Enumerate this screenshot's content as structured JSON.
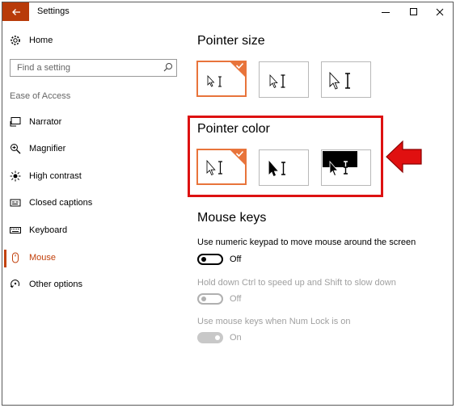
{
  "window": {
    "title": "Settings",
    "accent_color": "#b83b0a"
  },
  "sidebar": {
    "home_label": "Home",
    "search_placeholder": "Find a setting",
    "group_label": "Ease of Access",
    "items": [
      {
        "label": "Narrator",
        "icon": "narrator-icon"
      },
      {
        "label": "Magnifier",
        "icon": "magnifier-icon"
      },
      {
        "label": "High contrast",
        "icon": "high-contrast-icon"
      },
      {
        "label": "Closed captions",
        "icon": "closed-captions-icon"
      },
      {
        "label": "Keyboard",
        "icon": "keyboard-icon"
      },
      {
        "label": "Mouse",
        "icon": "mouse-icon",
        "active": true
      },
      {
        "label": "Other options",
        "icon": "other-options-icon"
      }
    ]
  },
  "main": {
    "pointer_size": {
      "title": "Pointer size",
      "options": [
        "small",
        "medium",
        "large"
      ],
      "selected": "small"
    },
    "pointer_color": {
      "title": "Pointer color",
      "options": [
        "white",
        "black",
        "inverted"
      ],
      "selected": "white",
      "highlight_color": "#dd1111"
    },
    "mouse_keys": {
      "title": "Mouse keys",
      "setting1": {
        "label": "Use numeric keypad to move mouse around the screen",
        "state": "Off"
      },
      "setting2": {
        "label": "Hold down Ctrl to speed up and Shift to slow down",
        "state": "Off",
        "disabled": true
      },
      "setting3": {
        "label": "Use mouse keys when Num Lock is on",
        "state": "On",
        "disabled": true
      }
    }
  }
}
